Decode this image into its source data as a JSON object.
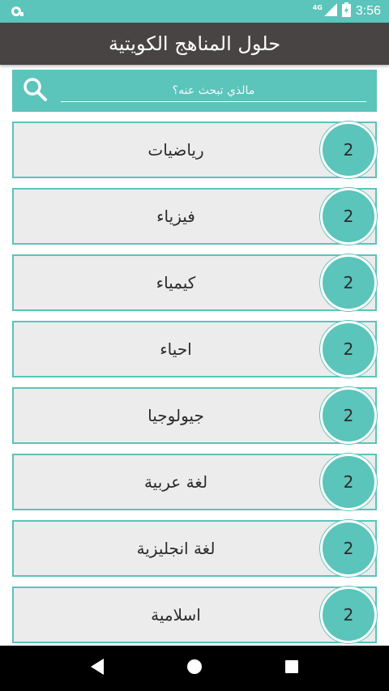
{
  "status_bar": {
    "network": "4G",
    "time": "3:56"
  },
  "app_bar": {
    "title": "حلول المناهج الكويتية"
  },
  "search": {
    "placeholder": "مالذي تبحث عنه؟"
  },
  "subjects": [
    {
      "label": "رياضيات",
      "badge": "2"
    },
    {
      "label": "فيزياء",
      "badge": "2"
    },
    {
      "label": "كيمياء",
      "badge": "2"
    },
    {
      "label": "احياء",
      "badge": "2"
    },
    {
      "label": "جيولوجيا",
      "badge": "2"
    },
    {
      "label": "لغة عربية",
      "badge": "2"
    },
    {
      "label": "لغة انجليزية",
      "badge": "2"
    },
    {
      "label": "اسلامية",
      "badge": "2"
    }
  ],
  "colors": {
    "accent": "#5bc4bb",
    "app_bar": "#484443",
    "item_bg": "#ececec",
    "nav_bar": "#000000"
  },
  "icons": {
    "status_left": "notification-icon",
    "signal": "signal-icon",
    "battery": "battery-icon",
    "search": "search-icon",
    "back": "back-triangle-icon",
    "home": "home-circle-icon",
    "recents": "recents-square-icon"
  }
}
